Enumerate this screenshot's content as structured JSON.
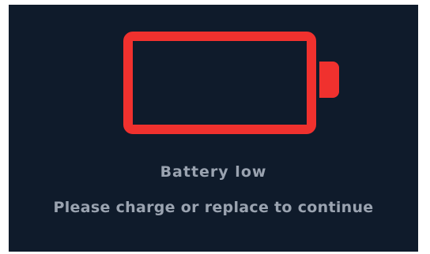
{
  "status": {
    "title": "Battery low",
    "message": "Please charge or replace to continue"
  },
  "icons": {
    "battery": "battery-empty-icon"
  },
  "colors": {
    "background": "#0f1b2b",
    "battery_outline": "#f0312e",
    "text": "#9aa3b0"
  }
}
